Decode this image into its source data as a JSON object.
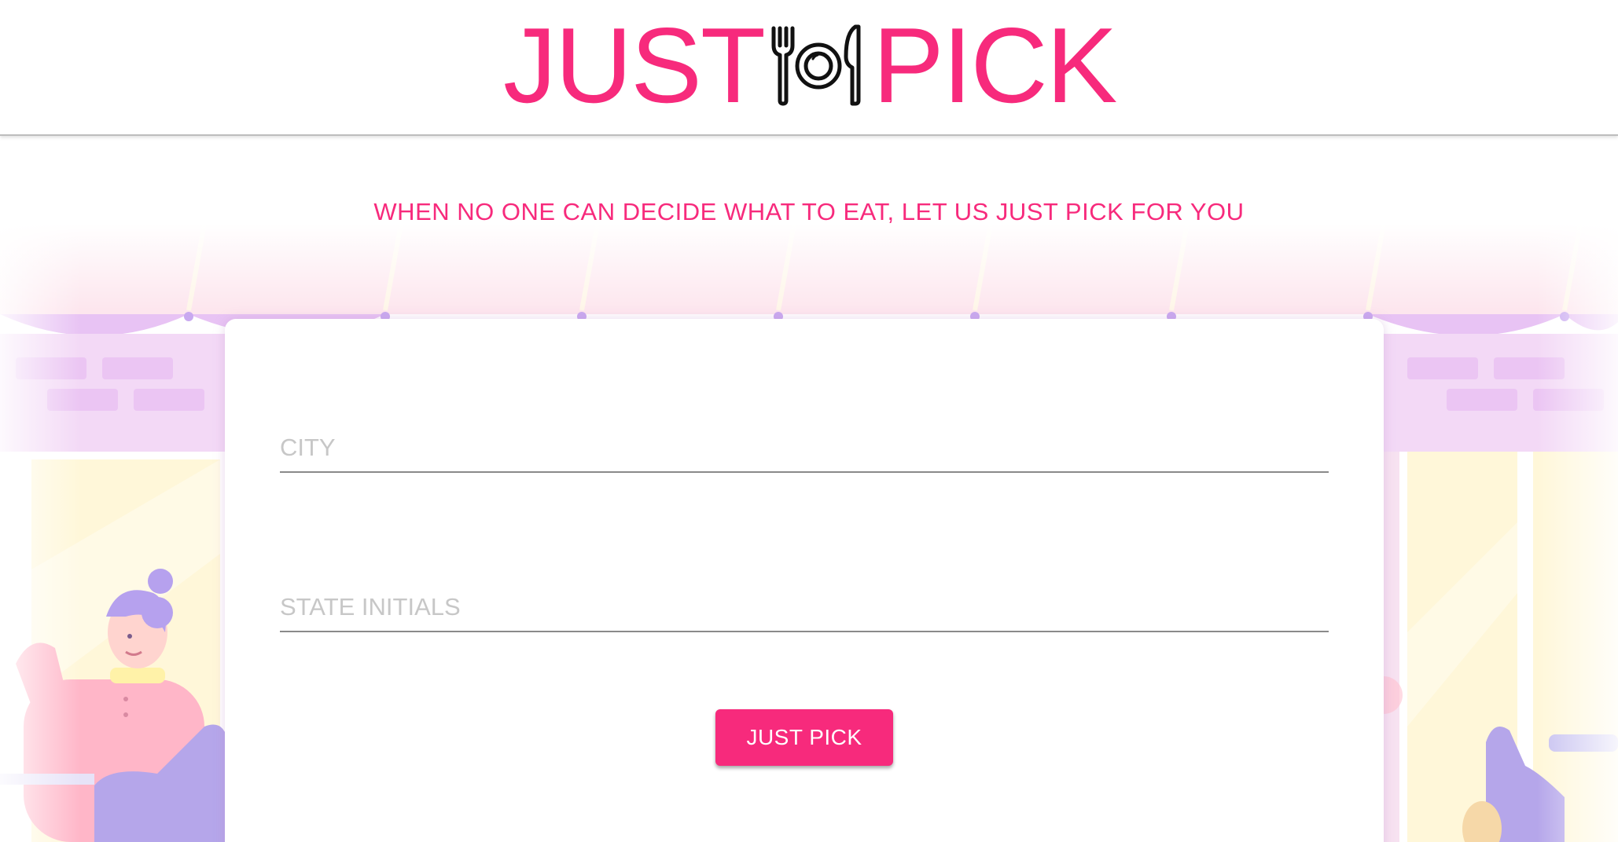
{
  "brand": {
    "word_left": "JUST",
    "word_right": "PICK",
    "emblem_icon": "fork-plate-knife-icon",
    "accent_color": "#f72a7c"
  },
  "tagline": "WHEN NO ONE CAN DECIDE WHAT TO EAT, LET US JUST PICK FOR YOU",
  "form": {
    "city": {
      "value": "",
      "placeholder": "CITY"
    },
    "state": {
      "value": "",
      "placeholder": "STATE INITIALS"
    },
    "submit_label": "JUST PICK"
  },
  "background": {
    "illustration": "restaurant-scene-illustration",
    "palette": [
      "#fce4ee",
      "#e9c8f5",
      "#b7a7ea",
      "#fff7d6",
      "#ffb3c7"
    ]
  }
}
